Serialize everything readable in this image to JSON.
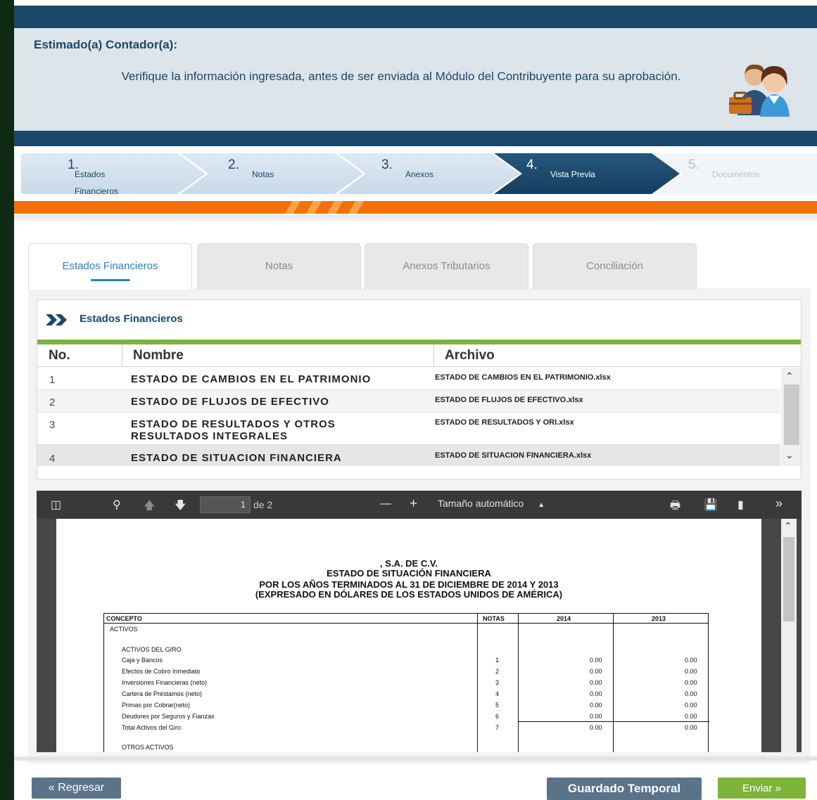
{
  "header": {
    "title": "Estimado(a) Contador(a):",
    "message": "Verifique la información ingresada, antes de ser enviada al Módulo del Contribuyente para su aprobación."
  },
  "wizard": {
    "steps": [
      {
        "num": "1.",
        "label": "Estados Financieros",
        "state": "done"
      },
      {
        "num": "2.",
        "label": "Notas",
        "state": "done"
      },
      {
        "num": "3.",
        "label": "Anexos",
        "state": "done"
      },
      {
        "num": "4.",
        "label": "Vista Previa",
        "state": "active"
      },
      {
        "num": "5.",
        "label": "Documentos",
        "state": "disabled"
      }
    ]
  },
  "tabs": [
    {
      "label": "Estados Financieros",
      "active": true
    },
    {
      "label": "Notas",
      "active": false
    },
    {
      "label": "Anexos Tributarios",
      "active": false
    },
    {
      "label": "Conciliación",
      "active": false
    }
  ],
  "section": {
    "title": "Estados Financieros",
    "columns": [
      "No.",
      "Nombre",
      "Archivo"
    ],
    "rows": [
      {
        "no": "1",
        "nombre": "ESTADO DE CAMBIOS EN EL PATRIMONIO",
        "archivo": "ESTADO DE CAMBIOS EN EL PATRIMONIO.xlsx"
      },
      {
        "no": "2",
        "nombre": "ESTADO DE FLUJOS DE EFECTIVO",
        "archivo": "ESTADO DE FLUJOS DE EFECTIVO.xlsx"
      },
      {
        "no": "3",
        "nombre": "ESTADO DE RESULTADOS Y OTROS RESULTADOS INTEGRALES",
        "archivo": "ESTADO DE RESULTADOS Y ORI.xlsx"
      },
      {
        "no": "4",
        "nombre": "ESTADO DE SITUACION FINANCIERA",
        "archivo": "ESTADO DE SITUACION FINANCIERA.xlsx"
      }
    ]
  },
  "pdf": {
    "page_current": "1",
    "page_total": "de 2",
    "zoom": "Tamaño automático",
    "doc": {
      "line1": ", S.A. DE C.V.",
      "line2": "ESTADO DE SITUACIÓN FINANCIERA",
      "line3": "POR LOS AÑOS TERMINADOS AL 31 DE DICIEMBRE DE 2014 Y 2013",
      "line4": "(EXPRESADO EN DÓLARES DE LOS ESTADOS UNIDOS DE AMÉRICA)",
      "col_concepto": "CONCEPTO",
      "col_notas": "NOTAS",
      "col_2014": "2014",
      "col_2013": "2013",
      "activos": "ACTIVOS",
      "activos_giro": "ACTIVOS DEL GIRO",
      "items": [
        {
          "label": "Caja y Bancos",
          "nota": "1",
          "v2014": "0.00",
          "v2013": "0.00"
        },
        {
          "label": "Efectos de Cobro Inmediato",
          "nota": "2",
          "v2014": "0.00",
          "v2013": "0.00"
        },
        {
          "label": "Inversiones Financieras (neto)",
          "nota": "3",
          "v2014": "0.00",
          "v2013": "0.00"
        },
        {
          "label": "Cartera de Préstamos (neto)",
          "nota": "4",
          "v2014": "0.00",
          "v2013": "0.00"
        },
        {
          "label": "Primas por Cobrar(neto)",
          "nota": "5",
          "v2014": "0.00",
          "v2013": "0.00"
        },
        {
          "label": "Deudores por Seguros y Fianzas",
          "nota": "6",
          "v2014": "0.00",
          "v2013": "0.00"
        },
        {
          "label": "Total Activos del Giro",
          "nota": "7",
          "v2014": "0.00",
          "v2013": "0.00"
        }
      ],
      "otros": "OTROS ACTIVOS"
    }
  },
  "footer": {
    "back": "« Regresar",
    "save": "Guardado Temporal",
    "send": "Enviar »"
  },
  "colors": {
    "navy": "#1a4869",
    "orange": "#f0700e",
    "green": "#7db43a",
    "tab_blue": "#2c7fc1"
  }
}
